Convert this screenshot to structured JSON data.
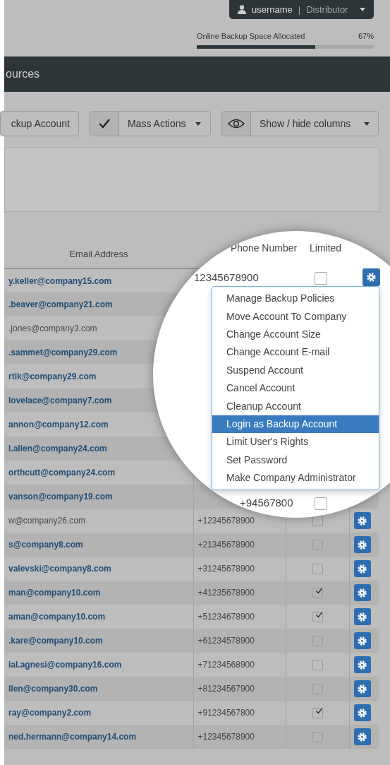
{
  "user_menu": {
    "username": "username",
    "separator": "|",
    "role": "Distributor"
  },
  "storage": {
    "label": "Online Backup Space Allocated",
    "reading": "67%",
    "level": 0.67
  },
  "title_bar": {
    "title": "ources"
  },
  "toolbar": {
    "add_button": "ckup Account",
    "mass_actions": "Mass Actions",
    "columns_button": "Show / hide columns"
  },
  "table": {
    "columns": [
      "Email Address"
    ],
    "rows": [
      {
        "email": "y.keller@company15.com",
        "link": true
      },
      {
        "email": ".beaver@company21.com",
        "link": true
      },
      {
        "email": ".jones@company3.com",
        "link": false
      },
      {
        "email": ".sammet@company29.com",
        "link": true
      },
      {
        "email": "rtik@company29.com",
        "link": true
      },
      {
        "email": "lovelace@company7.com",
        "link": true
      },
      {
        "email": "annon@company12.com",
        "link": true
      },
      {
        "email": "l.allen@company24.com",
        "link": true
      },
      {
        "email": "orthcutt@company24.com",
        "link": true
      },
      {
        "email": "vanson@company19.com",
        "link": true
      },
      {
        "email": "w@company26.com",
        "link": false,
        "phone": "+12345678900",
        "limited": false
      },
      {
        "email": "s@company8.com",
        "link": true,
        "phone": "+21345678900",
        "limited": false
      },
      {
        "email": "valevski@company8.com",
        "link": true,
        "phone": "+31245678900",
        "limited": false
      },
      {
        "email": "man@company10.com",
        "link": true,
        "phone": "+41235678900",
        "limited": true
      },
      {
        "email": "aman@company10.com",
        "link": true,
        "phone": "+51234678900",
        "limited": true
      },
      {
        "email": ".kare@company10.com",
        "link": true,
        "phone": "+61234578900",
        "limited": false
      },
      {
        "email": "ial.agnesi@company16.com",
        "link": true,
        "phone": "+71234568900",
        "limited": false
      },
      {
        "email": "llen@company30.com",
        "link": true,
        "phone": "+81234567900",
        "limited": false
      },
      {
        "email": "ray@company2.com",
        "link": true,
        "phone": "+91234567800",
        "limited": true
      },
      {
        "email": "ned.hermann@company14.com",
        "link": true,
        "phone": "+12345678900",
        "limited": false
      }
    ]
  },
  "magnifier": {
    "columns": [
      "Phone Number",
      "Limited"
    ],
    "rows": [
      {
        "phone": "12345678900",
        "limited": false
      },
      {
        "phone": "+94567800",
        "limited": false
      }
    ],
    "menu": [
      {
        "label": "Manage Backup Policies",
        "selected": false
      },
      {
        "label": "Move Account To Company",
        "selected": false
      },
      {
        "label": "Change Account Size",
        "selected": false
      },
      {
        "label": "Change Account E-mail",
        "selected": false
      },
      {
        "label": "Suspend Account",
        "selected": false
      },
      {
        "label": "Cancel Account",
        "selected": false
      },
      {
        "label": "Cleanup Account",
        "selected": false
      },
      {
        "label": "Login as Backup Account",
        "selected": true
      },
      {
        "label": "Limit User's Rights",
        "selected": false
      },
      {
        "label": "Set Password",
        "selected": false
      },
      {
        "label": "Make Company Administrator",
        "selected": false
      }
    ]
  }
}
